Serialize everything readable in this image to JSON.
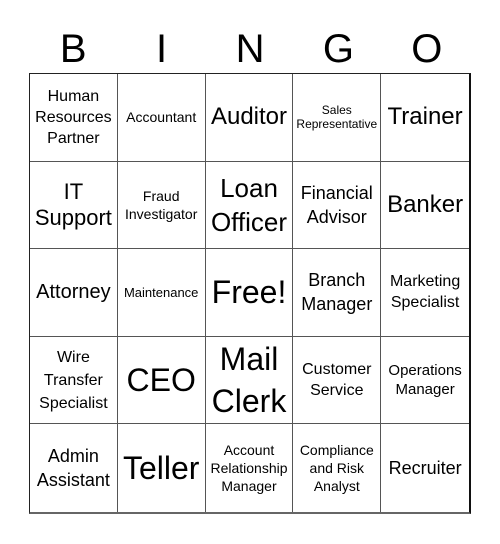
{
  "header": {
    "letters": [
      "B",
      "I",
      "N",
      "G",
      "O"
    ]
  },
  "cells": [
    "Human Resources Partner",
    "Accountant",
    "Auditor",
    "Sales Representative",
    "Trainer",
    "IT Support",
    "Fraud Investigator",
    "Loan Officer",
    "Financial Advisor",
    "Banker",
    "Attorney",
    "Maintenance",
    "Free!",
    "Branch Manager",
    "Marketing Specialist",
    "Wire Transfer Specialist",
    "CEO",
    "Mail Clerk",
    "Customer Service",
    "Operations Manager",
    "Admin Assistant",
    "Teller",
    "Account Relationship Manager",
    "Compliance and Risk Analyst",
    "Recruiter"
  ]
}
